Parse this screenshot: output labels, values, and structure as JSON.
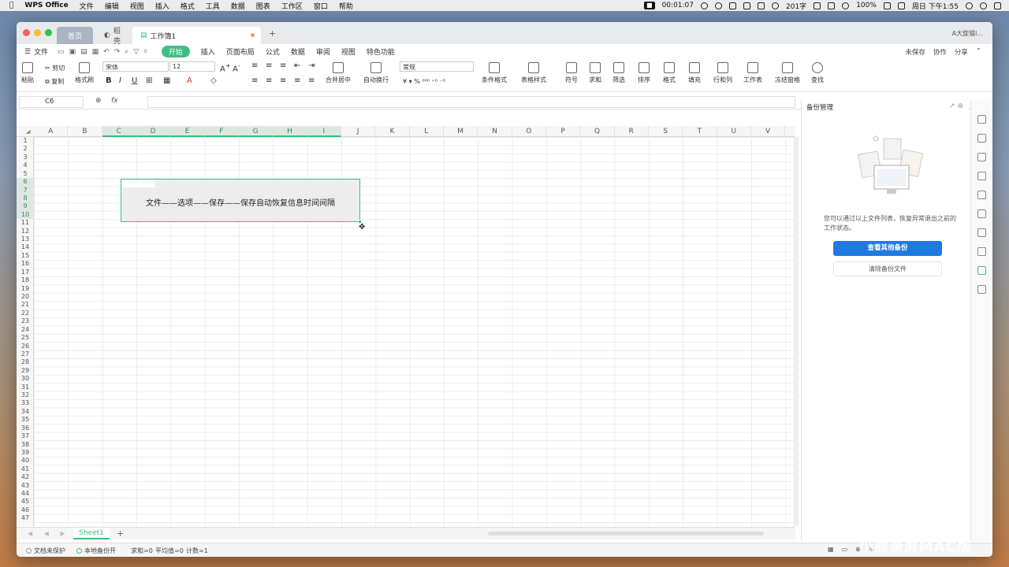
{
  "menubar": {
    "apple": "",
    "app": "WPS Office",
    "items": [
      "文件",
      "编辑",
      "视图",
      "插入",
      "格式",
      "工具",
      "数据",
      "图表",
      "工作区",
      "窗口",
      "帮助"
    ],
    "rec_time": "00:01:07",
    "status": [
      "201字",
      "100%",
      "周日 下午1:55"
    ]
  },
  "tabs": {
    "home": "首页",
    "shell": "稻壳",
    "book": "工作簿1",
    "plus": "+",
    "user": "A大旋猫l..."
  },
  "menu": {
    "file": "文件",
    "start": "开始",
    "items": [
      "插入",
      "页面布局",
      "公式",
      "数据",
      "审阅",
      "视图",
      "特色功能"
    ],
    "right": [
      "未保存",
      "协作",
      "分享"
    ]
  },
  "ribbon": {
    "paste": "粘贴",
    "cut": "剪切",
    "copy": "复制",
    "format_painter": "格式刷",
    "font": "宋体",
    "size": "12",
    "number_format": "常规",
    "merge": "合并居中",
    "wrap": "自动换行",
    "cond": "条件格式",
    "table_style": "表格样式",
    "symbol": "符号",
    "sum": "求和",
    "filter": "筛选",
    "sort": "排序",
    "format": "格式",
    "fill": "填充",
    "rowcol": "行和列",
    "sheet": "工作表",
    "freeze": "冻结窗格",
    "find": "查找"
  },
  "formula": {
    "cellref": "C6",
    "fx": "fx",
    "value": ""
  },
  "columns": [
    "A",
    "B",
    "C",
    "D",
    "E",
    "F",
    "G",
    "H",
    "I",
    "J",
    "K",
    "L",
    "M",
    "N",
    "O",
    "P",
    "Q",
    "R",
    "S",
    "T",
    "U",
    "V"
  ],
  "rows": [
    "1",
    "2",
    "3",
    "4",
    "5",
    "6",
    "7",
    "8",
    "9",
    "10",
    "11",
    "12",
    "13",
    "14",
    "15",
    "16",
    "17",
    "18",
    "19",
    "20",
    "21",
    "22",
    "23",
    "24",
    "25",
    "26",
    "27",
    "28",
    "29",
    "30",
    "31",
    "32",
    "33",
    "34",
    "35",
    "36",
    "37",
    "38",
    "39",
    "40",
    "41",
    "42",
    "43",
    "44",
    "45",
    "46",
    "47"
  ],
  "cell_text": "文件——选项——保存——保存自动恢复信息时间间隔",
  "sheet": {
    "name": "Sheet1",
    "add": "+"
  },
  "status": {
    "protect": "文档未保护",
    "backup": "本地备份开",
    "sum": "求和=0",
    "avg": "平均值=0",
    "count": "计数=1"
  },
  "panel": {
    "title": "备份管理",
    "desc": "您可以通过以上文件列表，恢复异常退出之前的工作状态。",
    "primary": "查看其他备份",
    "secondary": "清除备份文件"
  },
  "watermark": "小熊录屏MAC版",
  "colors": {
    "accent": "#3dbf7f",
    "primary_blue": "#1f7ae0"
  }
}
